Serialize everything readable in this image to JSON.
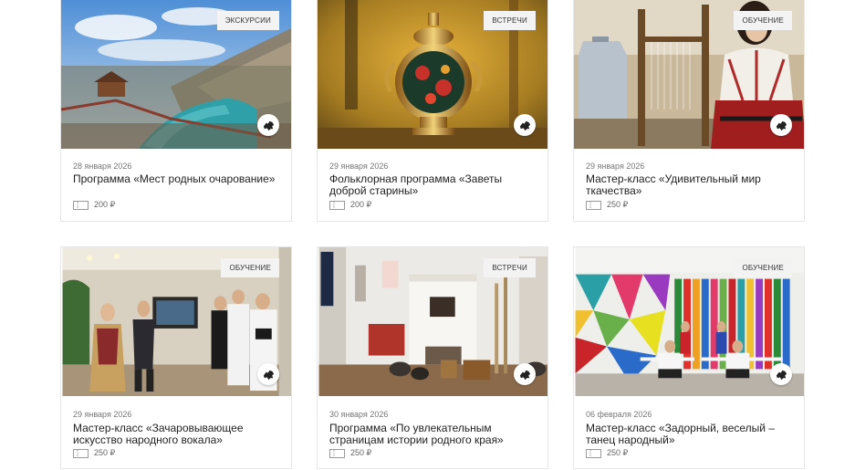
{
  "events": [
    {
      "category": "ЭКСКУРСИИ",
      "date": "28 января 2026",
      "title": "Программа «Мест родных очарование»",
      "price": "200 ₽",
      "photo_icon": "landscape-photo"
    },
    {
      "category": "ВСТРЕЧИ",
      "date": "29 января 2026",
      "title": "Фольклорная программа «Заветы доброй старины»",
      "price": "200 ₽",
      "photo_icon": "samovar-photo"
    },
    {
      "category": "ОБУЧЕНИЕ",
      "date": "29 января 2026",
      "title": "Мастер-класс «Удивительный мир ткачества»",
      "price": "250 ₽",
      "photo_icon": "weaving-photo"
    },
    {
      "category": "ОБУЧЕНИЕ",
      "date": "29 января 2026",
      "title": "Мастер-класс «Зачаровывающее искусство народного вокала»",
      "price": "250 ₽",
      "photo_icon": "vocal-photo"
    },
    {
      "category": "ВСТРЕЧИ",
      "date": "30 января 2026",
      "title": "Программа «По увлекательным страницам истории родного края»",
      "price": "250 ₽",
      "photo_icon": "museum-photo"
    },
    {
      "category": "ОБУЧЕНИЕ",
      "date": "06 февраля 2026",
      "title": "Мастер-класс «Задорный, веселый – танец народный»",
      "price": "250 ₽",
      "photo_icon": "dance-photo"
    }
  ],
  "colors": {
    "badge_bg": "#f3f3f3",
    "border": "#e6e6e6",
    "date": "#777777"
  }
}
